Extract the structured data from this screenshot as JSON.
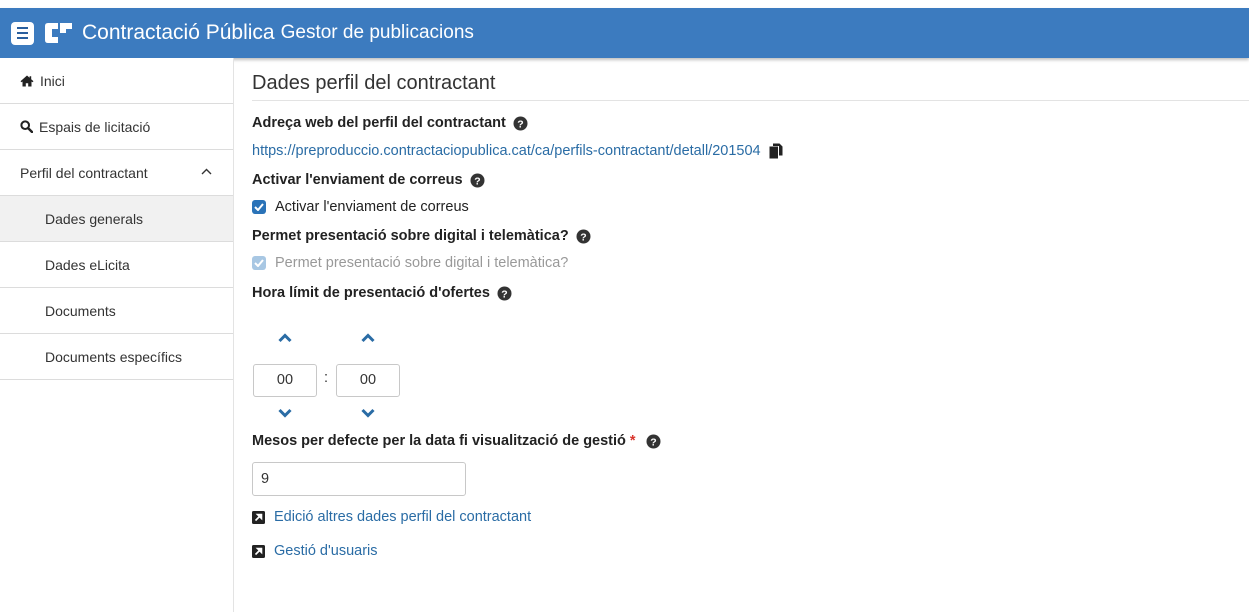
{
  "header": {
    "brand": "Contractació Pública",
    "subtitle": "Gestor de publicacions",
    "icons": {
      "menu": "hamburger-icon",
      "logo": "contractacio-logo"
    },
    "color": "#3c7bbf"
  },
  "sidebar": {
    "items": [
      {
        "label": "Inici",
        "icon": "home-icon"
      },
      {
        "label": "Espais de licitació",
        "icon": "search-icon"
      },
      {
        "label": "Perfil del contractant",
        "icon": "chevron-up-icon"
      }
    ],
    "subitems": [
      {
        "label": "Dades generals",
        "active": true
      },
      {
        "label": "Dades eLicita"
      },
      {
        "label": "Documents"
      },
      {
        "label": "Documents específics"
      }
    ]
  },
  "main": {
    "title": "Dades perfil del contractant",
    "web_label": "Adreça web del perfil del contractant",
    "web_url": "https://preproduccio.contractaciopublica.cat/ca/perfils-contractant/detall/201504",
    "email_label": "Activar l'enviament de correus",
    "email_checkbox": "Activar l'enviament de correus",
    "email_checked": true,
    "digital_label": "Permet presentació sobre digital i telemàtica?",
    "digital_checkbox": "Permet presentació sobre digital i telemàtica?",
    "digital_checked": true,
    "hour_label": "Hora límit de presentació d'ofertes",
    "hours": "00",
    "separator": ":",
    "minutes": "00",
    "months_label": "Mesos per defecte per la data fi visualització de gestió",
    "required_mark": "*",
    "months_value": "9",
    "edit_link": "Edició altres dades perfil del contractant",
    "users_link": "Gestió d'usuaris"
  },
  "colors": {
    "link": "#2a6ca5",
    "checkbox": "#2a73b8",
    "required": "#d9342b"
  }
}
